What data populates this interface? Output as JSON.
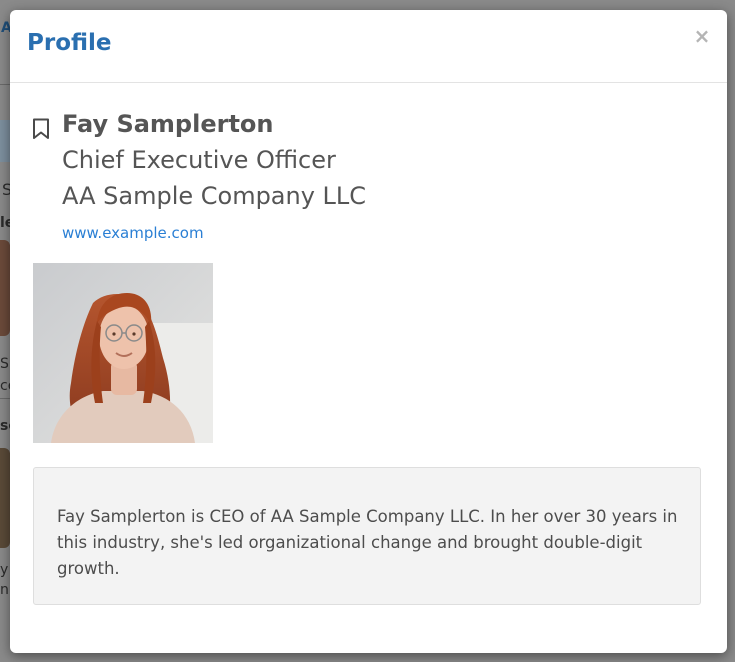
{
  "background": {
    "fragments": [
      "A",
      "S",
      "le",
      "S",
      "ce",
      "se",
      "y",
      "np"
    ]
  },
  "modal": {
    "title": "Profile",
    "close_label": "×"
  },
  "profile": {
    "name": "Fay Samplerton",
    "job_title": "Chief Executive Officer",
    "company": "AA Sample Company LLC",
    "website": "www.example.com",
    "bio": "Fay Samplerton is CEO of AA Sample Company LLC. In her over 30 years in this industry, she's led organizational change and brought double-digit growth."
  },
  "colors": {
    "title_blue": "#2a6fb0",
    "link_blue": "#2a7fd4",
    "text_gray": "#555555",
    "bio_bg": "#f3f3f3"
  }
}
